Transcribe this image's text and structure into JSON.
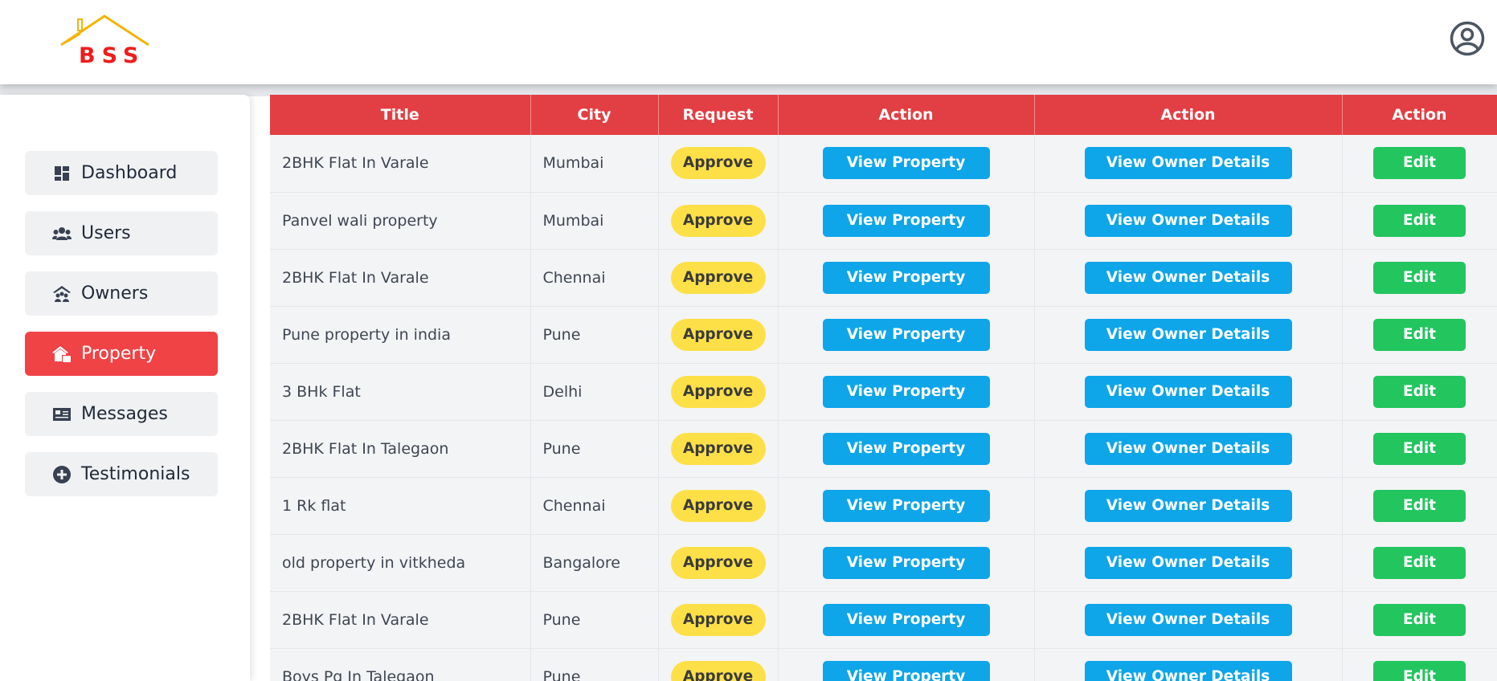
{
  "brand": {
    "logo_text": "BSS"
  },
  "header": {
    "profile_icon": "user-circle-icon"
  },
  "sidebar": {
    "items": [
      {
        "label": "Dashboard",
        "icon": "dashboard-icon",
        "active": false
      },
      {
        "label": "Users",
        "icon": "users-icon",
        "active": false
      },
      {
        "label": "Owners",
        "icon": "owners-icon",
        "active": false
      },
      {
        "label": "Property",
        "icon": "property-icon",
        "active": true
      },
      {
        "label": "Messages",
        "icon": "messages-icon",
        "active": false
      },
      {
        "label": "Testimonials",
        "icon": "plus-circle-icon",
        "active": false
      }
    ]
  },
  "table": {
    "headers": [
      "Title",
      "City",
      "Request",
      "Action",
      "Action",
      "Action"
    ],
    "approve_label": "Approve",
    "view_property_label": "View Property",
    "view_owner_label": "View Owner Details",
    "edit_label": "Edit",
    "rows": [
      {
        "title": "2BHK Flat In Varale",
        "city": "Mumbai"
      },
      {
        "title": "Panvel wali property",
        "city": "Mumbai"
      },
      {
        "title": "2BHK Flat In Varale",
        "city": "Chennai"
      },
      {
        "title": "Pune property in india",
        "city": "Pune"
      },
      {
        "title": "3 BHk Flat",
        "city": "Delhi"
      },
      {
        "title": "2BHK Flat In Talegaon",
        "city": "Pune"
      },
      {
        "title": "1 Rk flat",
        "city": "Chennai"
      },
      {
        "title": "old property in vitkheda",
        "city": "Bangalore"
      },
      {
        "title": "2BHK Flat In Varale",
        "city": "Pune"
      },
      {
        "title": "Boys Pg In Talegaon",
        "city": "Pune"
      }
    ]
  },
  "colors": {
    "accent_red": "#e23f44",
    "approve_yellow": "#fde047",
    "action_blue": "#0ea5e9",
    "edit_green": "#22c55e"
  }
}
